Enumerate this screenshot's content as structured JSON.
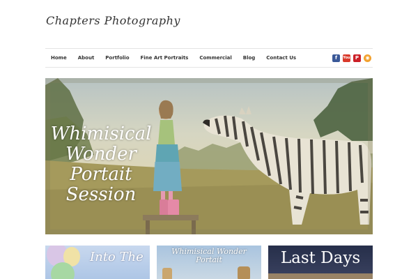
{
  "site": {
    "logo_text": "Chapters Photography"
  },
  "nav": {
    "items": [
      {
        "label": "Home",
        "name": "nav-item-home"
      },
      {
        "label": "About",
        "name": "nav-item-about"
      },
      {
        "label": "Portfolio",
        "name": "nav-item-portfolio"
      },
      {
        "label": "Fine Art Portraits",
        "name": "nav-item-fine-art-portraits"
      },
      {
        "label": "Commercial",
        "name": "nav-item-commercial"
      },
      {
        "label": "Blog",
        "name": "nav-item-blog"
      },
      {
        "label": "Contact Us",
        "name": "nav-item-contact-us"
      }
    ],
    "social": [
      {
        "icon": "facebook-icon",
        "glyph": "f",
        "cls": "si-fb"
      },
      {
        "icon": "youtube-icon",
        "glyph": "You",
        "cls": "si-yt"
      },
      {
        "icon": "pinterest-icon",
        "glyph": "P",
        "cls": "si-pin"
      },
      {
        "icon": "rss-icon",
        "glyph": "◉",
        "cls": "si-rss"
      }
    ]
  },
  "hero": {
    "title_lines": [
      "Whimisical",
      "Wonder",
      "Portait",
      "Session"
    ]
  },
  "thumbnails": [
    {
      "text": "Into The",
      "name": "thumbnail-into-the"
    },
    {
      "text": "Whimisical Wonder\nPortait",
      "name": "thumbnail-whimisical-wonder"
    },
    {
      "text": "Last Days",
      "name": "thumbnail-last-days"
    }
  ],
  "colors": {
    "nav_text": "#333333",
    "border": "#e4e4e4",
    "facebook": "#3b5998",
    "youtube": "#d93a2b",
    "pinterest": "#cb2027",
    "rss": "#f2a12e"
  }
}
